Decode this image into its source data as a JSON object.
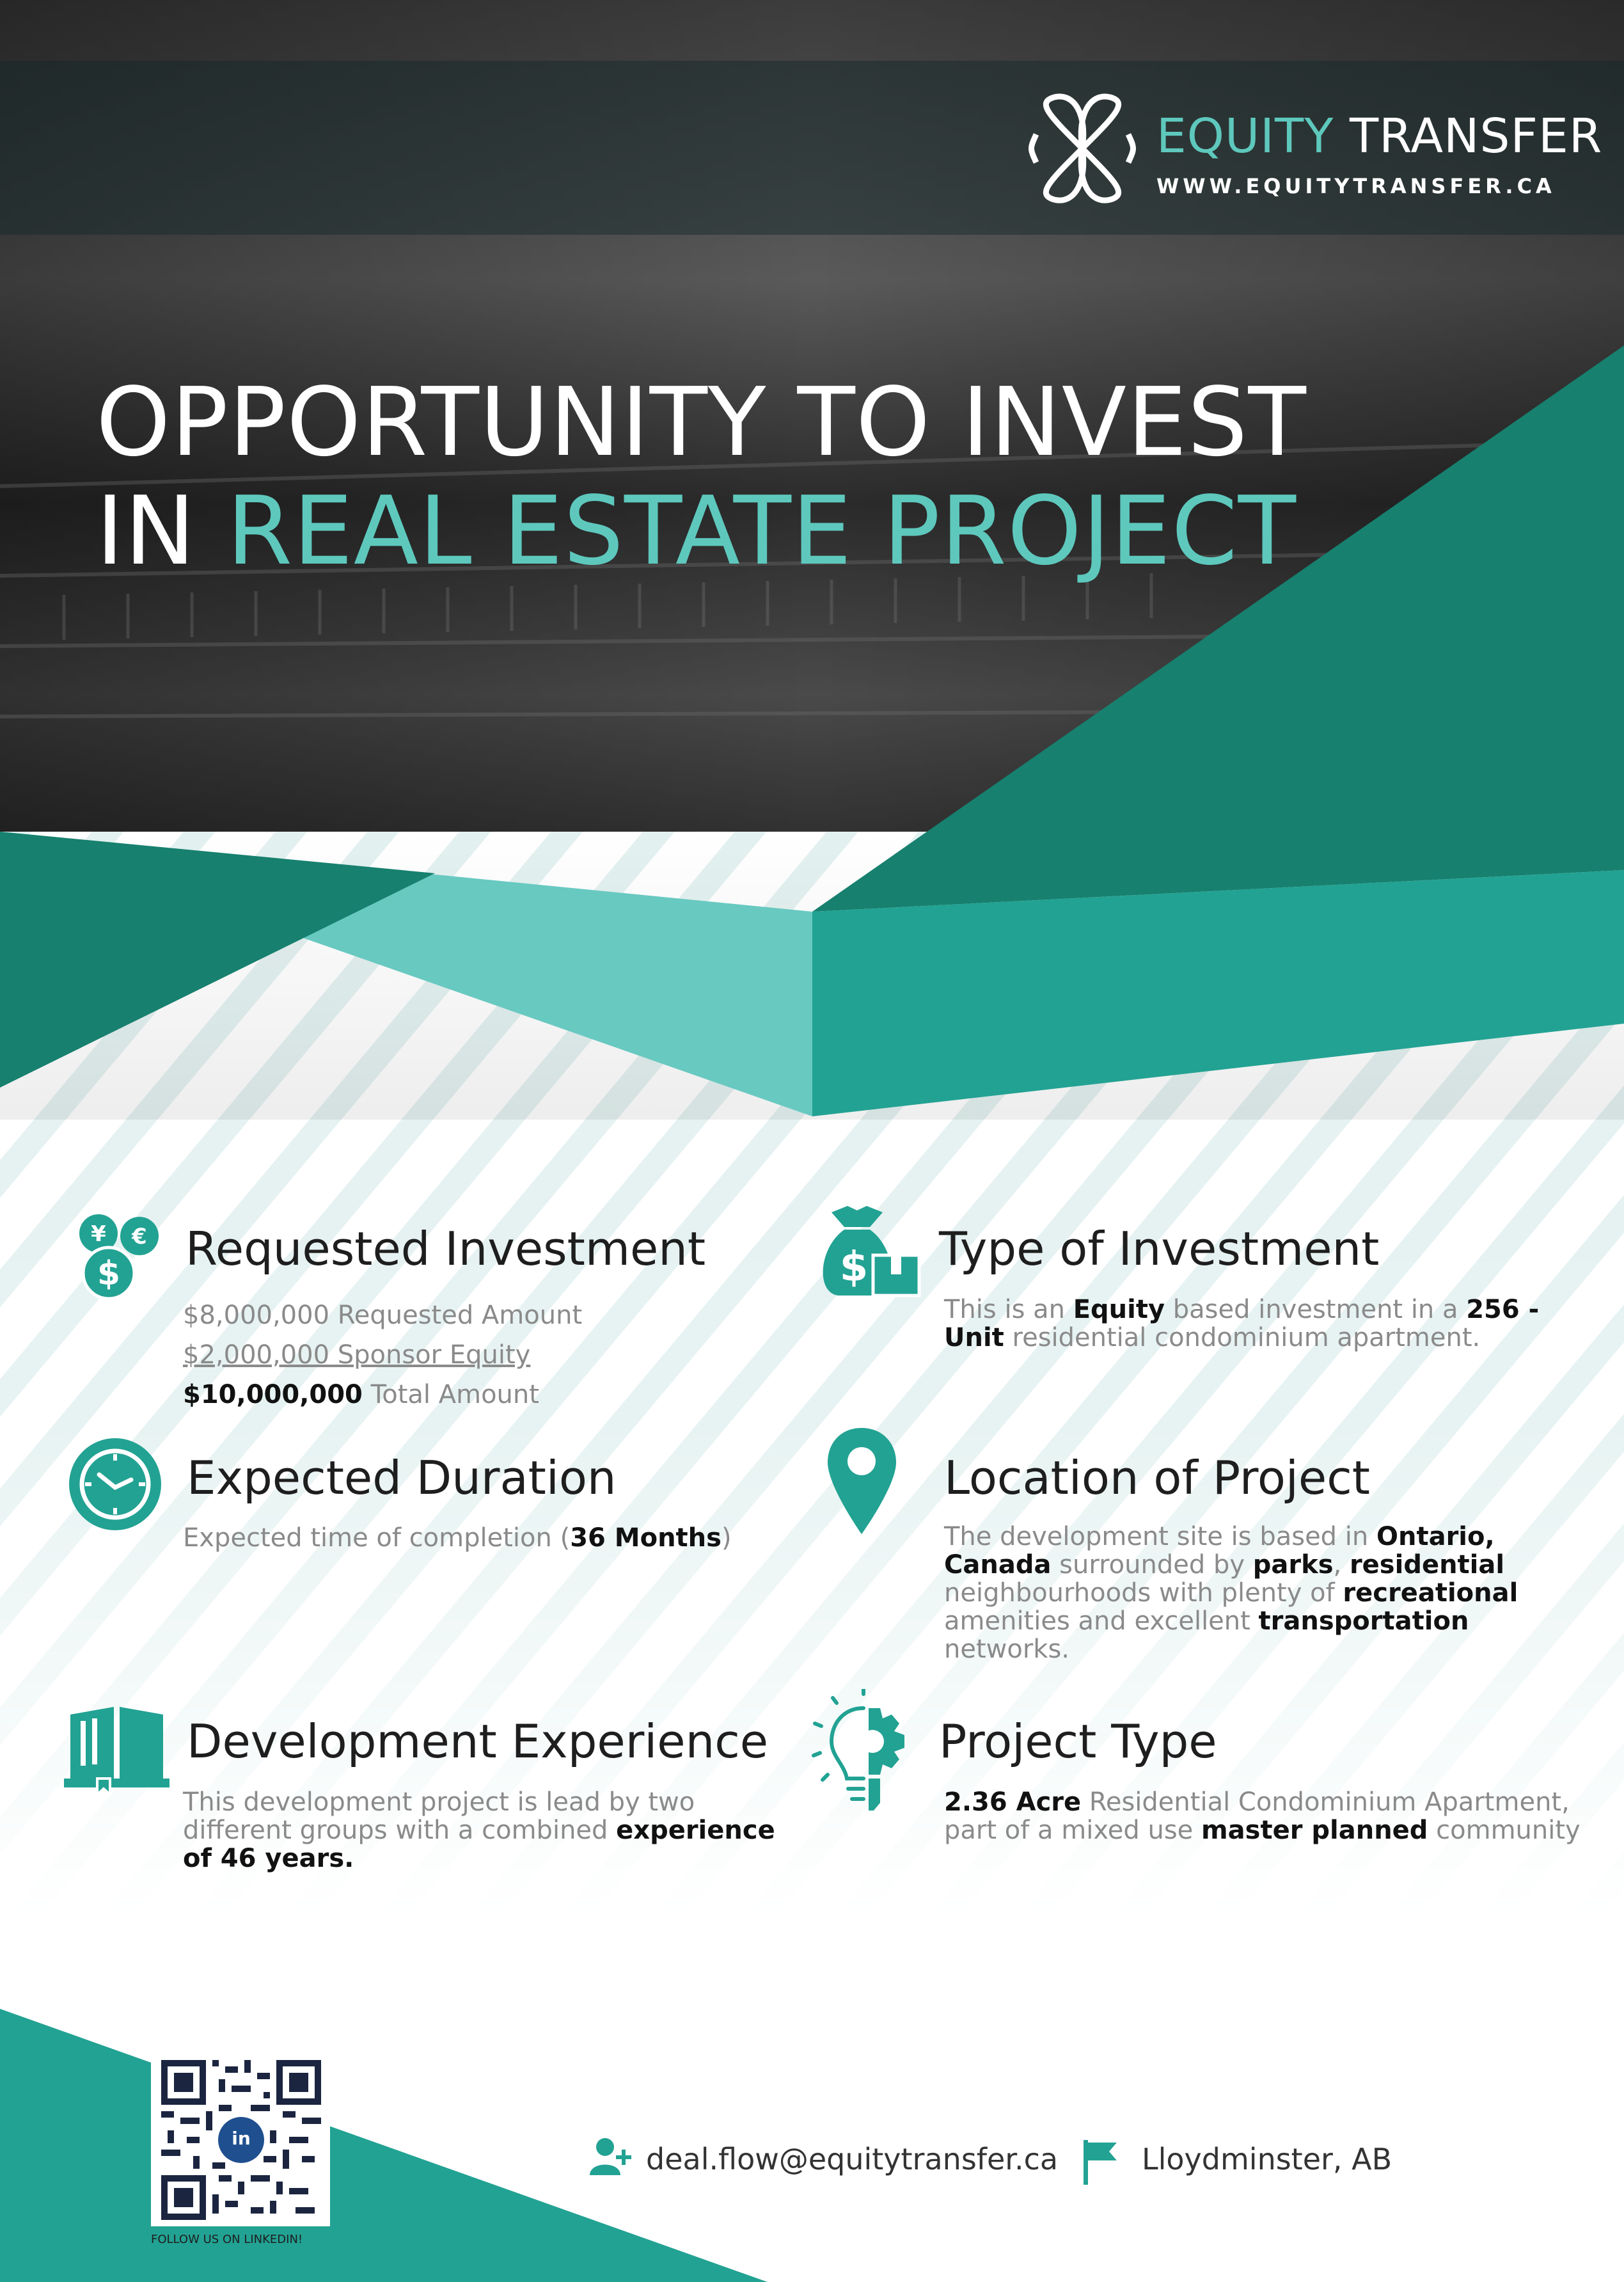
{
  "brand": {
    "name_part1": "EQUITY",
    "name_part2": "TRANSFER",
    "url": "WWW.EQUITYTRANSFER.CA"
  },
  "headline": {
    "line1": "OPPORTUNITY TO INVEST",
    "line2_prefix": "IN",
    "line2_accent": "REAL ESTATE PROJECT"
  },
  "sections": {
    "requested_investment": {
      "title": "Requested Investment",
      "line1": "$8,000,000 Requested Amount",
      "line2": "$2,000,000 Sponsor Equity",
      "line3_bold": "$10,000,000",
      "line3_rest": " Total Amount"
    },
    "type_of_investment": {
      "title": "Type of Investment",
      "t1": "This is an ",
      "b1": "Equity",
      "t2": " based investment in a ",
      "b2": "256 - Unit",
      "t3": " residential condominium apartment."
    },
    "expected_duration": {
      "title": "Expected Duration",
      "t1": "Expected time of completion (",
      "b1": "36 Months",
      "t2": ")"
    },
    "location": {
      "title": "Location of Project",
      "t1": "The development site is based in ",
      "b1": "Ontario, Canada",
      "t2": " surrounded by ",
      "b2": "parks",
      "t3": ", ",
      "b3": "residential",
      "t4": " neighbourhoods with plenty of ",
      "b4": "recreational",
      "t5": " amenities and excellent ",
      "b5": "transportation",
      "t6": " networks."
    },
    "development_experience": {
      "title": "Development Experience",
      "t1": "This development project is lead by two different groups with a combined ",
      "b1": "experience of 46 years."
    },
    "project_type": {
      "title": "Project Type",
      "b1": "2.36 Acre",
      "t1": " Residential Condominium Apartment, part of a mixed use ",
      "b2": "master planned",
      "t2": " community"
    }
  },
  "footer": {
    "email": "deal.flow@equitytransfer.ca",
    "location": "Lloydminster, AB",
    "follow": "FOLLOW US ON LINKEDIN!",
    "qr_badge": "in"
  },
  "colors": {
    "teal_dark": "#17806f",
    "teal": "#22a293",
    "teal_light": "#68c9c1",
    "stripe": "#e3f1f0"
  }
}
